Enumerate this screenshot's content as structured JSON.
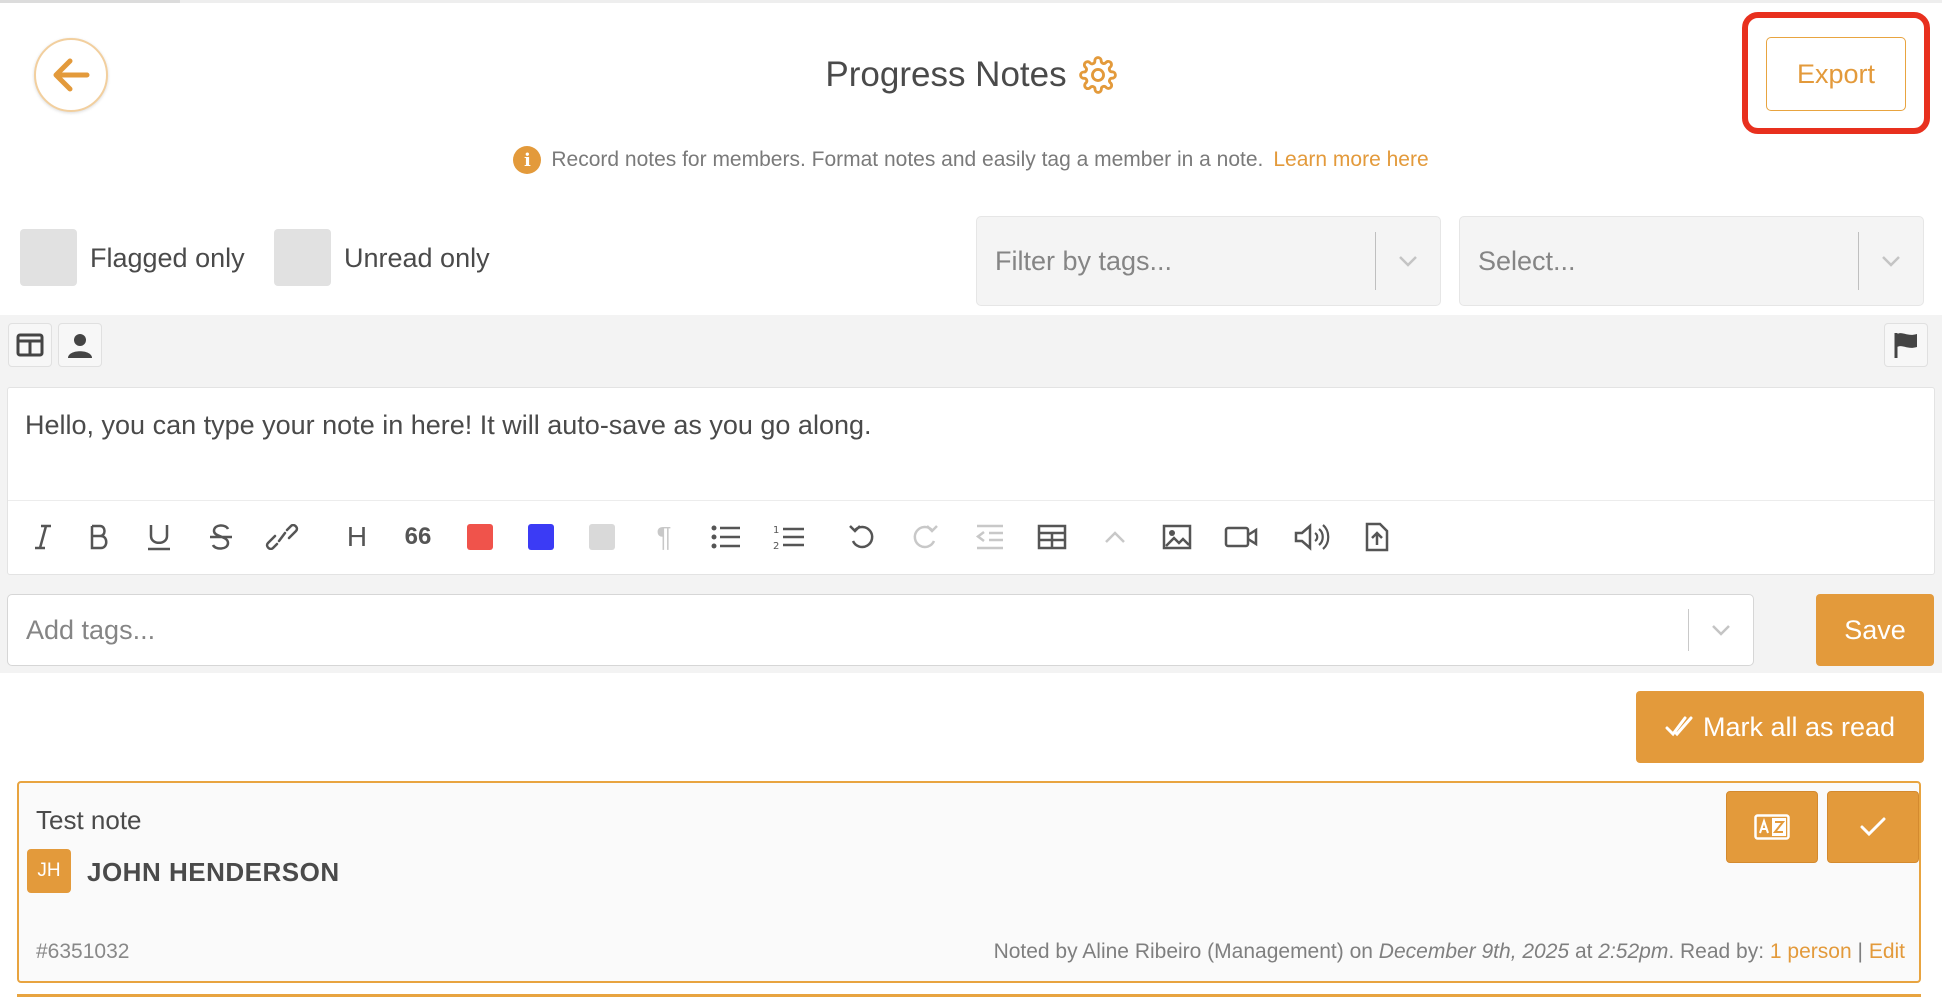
{
  "header": {
    "title": "Progress Notes",
    "export_label": "Export",
    "back_icon": "arrow-left-icon",
    "settings_icon": "gear-icon"
  },
  "info": {
    "text": "Record notes for members. Format notes and easily tag a member in a note.",
    "link_label": "Learn more here"
  },
  "filters": {
    "flagged_label": "Flagged only",
    "unread_label": "Unread only",
    "tags_placeholder": "Filter by tags...",
    "select_placeholder": "Select..."
  },
  "editor": {
    "content": "Hello, you can type your note in here! It will auto-save as you go along.",
    "heading_label": "H",
    "quote_label": "66",
    "toolbar": [
      "italic-icon",
      "bold-icon",
      "underline-icon",
      "strikethrough-icon",
      "link-icon",
      "heading-icon",
      "quote-icon",
      "text-color-red-icon",
      "text-color-blue-icon",
      "text-color-gray-icon",
      "paragraph-icon",
      "bullet-list-icon",
      "numbered-list-icon",
      "undo-icon",
      "redo-icon",
      "outdent-icon",
      "table-icon",
      "collapse-icon",
      "image-icon",
      "video-icon",
      "audio-icon",
      "file-upload-icon"
    ],
    "colors": {
      "red": "#f0534b",
      "blue": "#3b3bf5",
      "gray": "#d9d9d9"
    }
  },
  "tags": {
    "placeholder": "Add tags..."
  },
  "actions": {
    "save_label": "Save",
    "mark_all_label": "Mark all as read"
  },
  "note": {
    "title": "Test note",
    "avatar_initials": "JH",
    "member_name": "JOHN HENDERSON",
    "id": "#6351032",
    "noted_by": "Noted by Aline Ribeiro (Management)",
    "on_word": "on",
    "date": "December 9th, 2025",
    "at_word": "at",
    "time": "2:52pm",
    "read_by_label": ". Read by:",
    "read_by_value": "1 person",
    "separator": "|",
    "edit_label": "Edit"
  },
  "theme": {
    "accent": "#e39a3b",
    "highlight": "#e8301e"
  }
}
